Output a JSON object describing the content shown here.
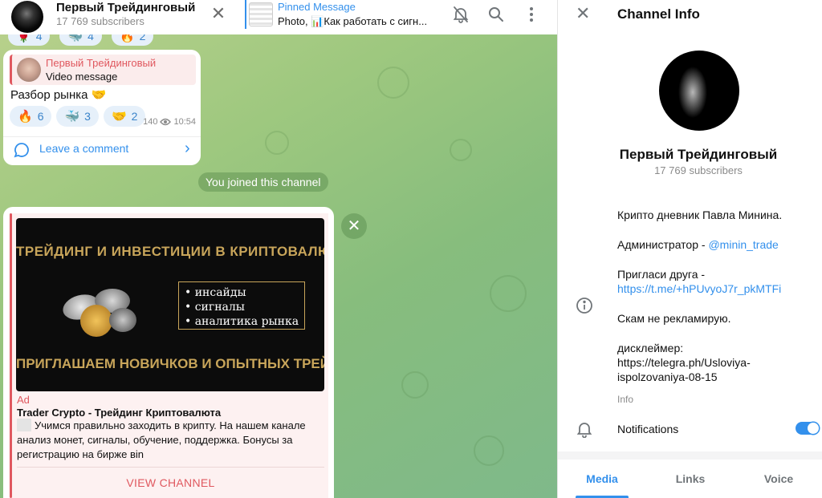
{
  "chat": {
    "title": "Первый Трейдинговый",
    "subscribers": "17 769 subscribers",
    "close_symbol": "✕",
    "pinned": {
      "title": "Pinned Message",
      "text": "Photo, 📊Как работать с сигн..."
    }
  },
  "top_reactions": [
    {
      "icon": "🌹",
      "count": "4"
    },
    {
      "icon": "🐳",
      "count": "4"
    },
    {
      "icon": "🔥",
      "count": "2"
    }
  ],
  "message1": {
    "reply_name": "Первый Трейдинговый",
    "reply_text": "Video message",
    "text": "Разбор рынка",
    "text_emoji": "🤝",
    "reactions": [
      {
        "icon": "🔥",
        "count": "6"
      },
      {
        "icon": "🐳",
        "count": "3"
      },
      {
        "icon": "🤝",
        "count": "2"
      }
    ],
    "views": "140",
    "time": "10:54",
    "comment_label": "Leave a comment"
  },
  "service_message": "You joined this channel",
  "ad": {
    "banner_title": "ТРЕЙДИНГ И ИНВЕСТИЦИИ В КРИПТОВАЛЮТУ",
    "banner_list": [
      "• инсайды",
      "• сигналы",
      "• аналитика рынка"
    ],
    "banner_sub": "ПРИГЛАШАЕМ НОВИЧКОВ И ОПЫТНЫХ ТРЕЙДЕРОВ",
    "label": "Ad",
    "title": "Trader Crypto - Трейдинг Криптовалюта",
    "body": "Учимся правильно заходить в крипту. На нашем канале анализ монет, сигналы, обучение, поддержка. Бонусы за регистрацию на бирже ʙin",
    "button": "VIEW CHANNEL",
    "close_symbol": "✕"
  },
  "info": {
    "close_symbol": "✕",
    "heading": "Channel Info",
    "name": "Первый Трейдинговый",
    "subscribers": "17 769 subscribers",
    "line1": "Крипто дневник Павла Минина.",
    "admin_prefix": "Администратор - ",
    "admin_link": "@minin_trade",
    "invite_prefix": "Пригласи друга -",
    "invite_link": "https://t.me/+hPUvyoJ7r_pkMTFi",
    "line4": "Скам не рекламирую.",
    "disclaimer_prefix": "дисклеймер:",
    "disclaimer_link": "https://telegra.ph/Usloviya-ispolzovaniya-08-15",
    "caption": "Info",
    "notifications_label": "Notifications",
    "notifications_on": true,
    "tabs": [
      "Media",
      "Links",
      "Voice"
    ]
  },
  "colors": {
    "accent": "#3390ec",
    "ad_red": "#e0585f",
    "banner_gold": "#c8a55a"
  }
}
